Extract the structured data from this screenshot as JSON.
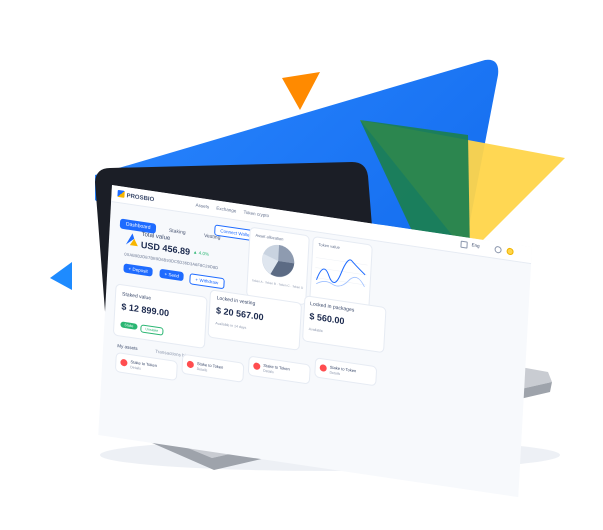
{
  "colors": {
    "blue": "#1e6bff",
    "deep_blue": "#0f5fe6",
    "orange": "#ff8a00",
    "yellow": "#ffd54a",
    "green": "#1b7f4f"
  },
  "topbar": {
    "logo": "PROSBIO",
    "breadcrumbs": [
      "Assets",
      "Exchange",
      "Token crypto"
    ],
    "language": "Eng"
  },
  "tabs": [
    "Dashboard",
    "Staking",
    "Vesting"
  ],
  "connect_button": "Connect Wallet",
  "total_value": {
    "label": "Total value",
    "value": "USD 456.89",
    "change": "4.0%",
    "address": "0XAB9B2DE7BE9D6B93DC5D36D3A6F8C29D8D"
  },
  "actions": [
    "Deposit",
    "Send",
    "Withdraw"
  ],
  "panels": {
    "allocation_title": "Asset allocation",
    "chart_title": "Token value",
    "legend": [
      "Token A",
      "Token B",
      "Token C",
      "Token D"
    ]
  },
  "stats": {
    "staked": {
      "label": "Staked value",
      "value": "$ 12 899.00",
      "pills": [
        "Stake",
        "Unstake"
      ]
    },
    "vesting": {
      "label": "Locked in vesting",
      "value": "$ 20 567.00",
      "sub": "Available in 14 days"
    },
    "packages": {
      "label": "Locked in packages",
      "value": "$ 560.00",
      "sub": "Available"
    }
  },
  "sections": {
    "my_assets": "My assets",
    "transactions": "Transactions history",
    "token_item_title": "Stake to Token",
    "token_item_sub": "Details"
  }
}
